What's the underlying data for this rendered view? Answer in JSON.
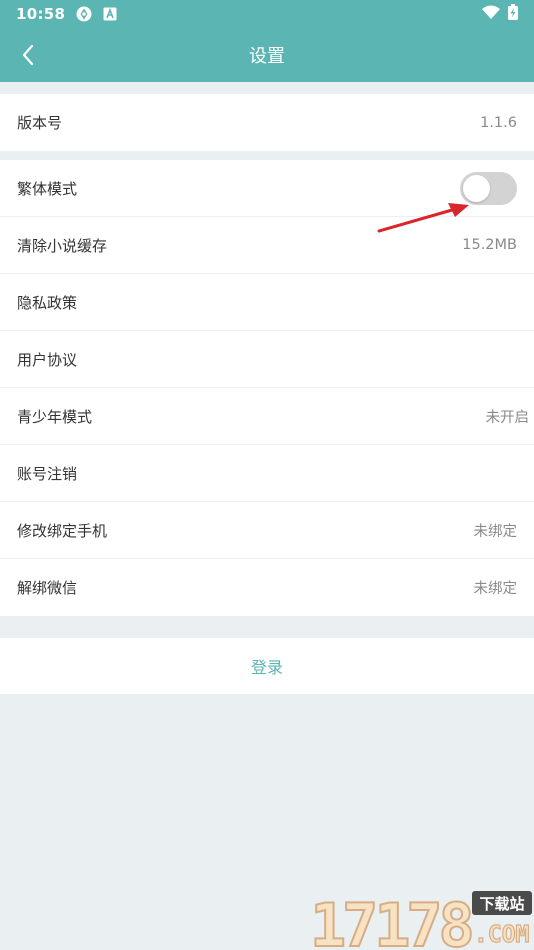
{
  "status_bar": {
    "time": "10:58",
    "icons": [
      "sync-icon",
      "text-a-icon",
      "wifi-icon",
      "battery-charging-icon"
    ]
  },
  "header": {
    "title": "设置",
    "back_icon": "chevron-left-icon"
  },
  "settings": {
    "version": {
      "label": "版本号",
      "value": "1.1.6"
    },
    "traditional_mode": {
      "label": "繁体模式",
      "enabled": false
    },
    "clear_cache": {
      "label": "清除小说缓存",
      "value": "15.2MB"
    },
    "privacy_policy": {
      "label": "隐私政策"
    },
    "user_agreement": {
      "label": "用户协议"
    },
    "teen_mode": {
      "label": "青少年模式",
      "value": "未开启"
    },
    "account_cancel": {
      "label": "账号注销"
    },
    "bind_phone": {
      "label": "修改绑定手机",
      "value": "未绑定"
    },
    "unbind_wechat": {
      "label": "解绑微信",
      "value": "未绑定"
    }
  },
  "login": {
    "label": "登录"
  },
  "watermark": {
    "number": "17178",
    "tag": "下载站",
    "domain": ".COM"
  },
  "colors": {
    "accent": "#5bb5b3",
    "background": "#eaeff2",
    "arrow": "#d8262a",
    "toggle_off": "#d3d3d3"
  }
}
